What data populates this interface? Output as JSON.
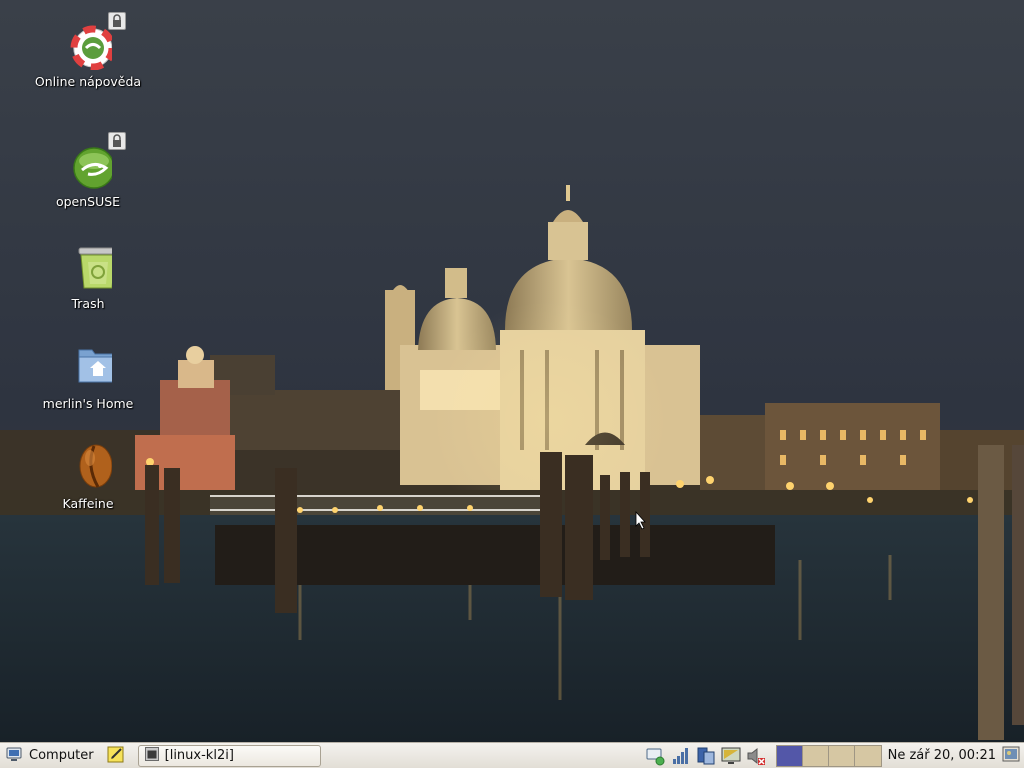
{
  "desktop": {
    "icons": [
      {
        "label": "Online nápověda",
        "icon": "help-lifebuoy-icon",
        "locked": true
      },
      {
        "label": "openSUSE",
        "icon": "opensuse-icon",
        "locked": true
      },
      {
        "label": "Trash",
        "icon": "trash-icon",
        "locked": false
      },
      {
        "label": "merlin's Home",
        "icon": "home-folder-icon",
        "locked": false
      },
      {
        "label": "Kaffeine",
        "icon": "kaffeine-icon",
        "locked": false
      }
    ]
  },
  "taskbar": {
    "menu_label": "Computer",
    "task_label": "[linux-kl2i]",
    "clock": "Ne zář 20, 00:21",
    "workspaces": {
      "count": 4,
      "active": 1
    },
    "tray_icons": [
      "network-manager-icon",
      "signal-strength-icon",
      "updater-icon",
      "display-icon",
      "volume-muted-icon"
    ]
  },
  "colors": {
    "taskbar_bg": "#ebe7df",
    "workspace_active": "#5357a8",
    "workspace_inactive": "#d6c7a3"
  }
}
